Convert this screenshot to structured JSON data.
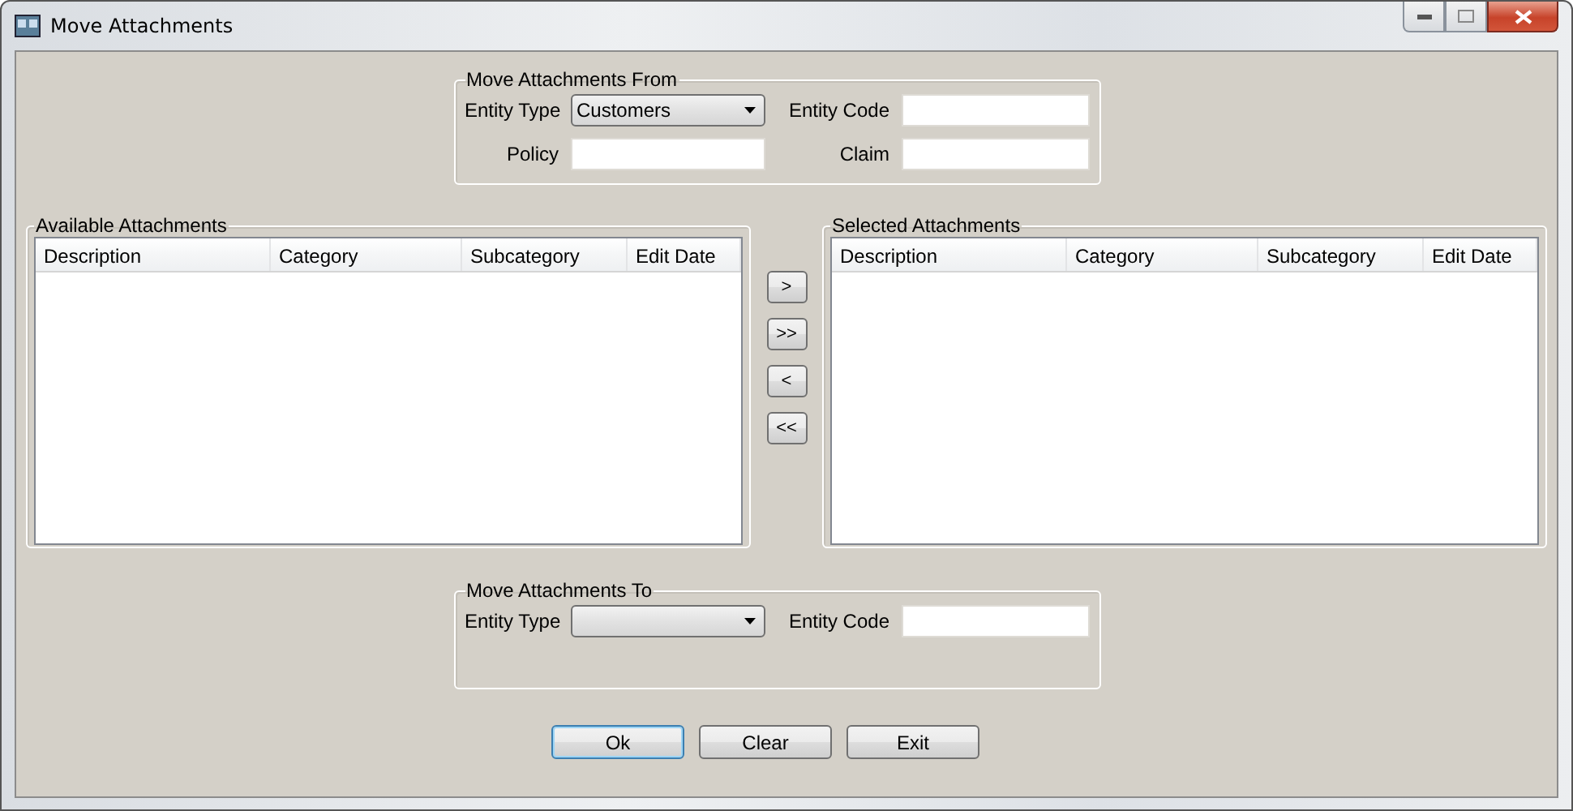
{
  "window": {
    "title": "Move Attachments"
  },
  "from_group": {
    "title": "Move Attachments From",
    "entity_type": {
      "label": "Entity Type",
      "value": "Customers"
    },
    "entity_code": {
      "label": "Entity Code"
    },
    "policy": {
      "label": "Policy"
    },
    "claim": {
      "label": "Claim"
    }
  },
  "available": {
    "title": "Available Attachments",
    "columns": [
      "Description",
      "Category",
      "Subcategory",
      "Edit Date"
    ]
  },
  "transfer_buttons": [
    ">",
    ">>",
    "<",
    "<<"
  ],
  "selected": {
    "title": "Selected Attachments",
    "columns": [
      "Description",
      "Category",
      "Subcategory",
      "Edit Date"
    ]
  },
  "to_group": {
    "title": "Move Attachments To",
    "entity_type": {
      "label": "Entity Type"
    },
    "entity_code": {
      "label": "Entity Code"
    }
  },
  "buttons": [
    {
      "label": "Ok",
      "default": true
    },
    {
      "label": "Clear",
      "default": false
    },
    {
      "label": "Exit",
      "default": false
    }
  ]
}
